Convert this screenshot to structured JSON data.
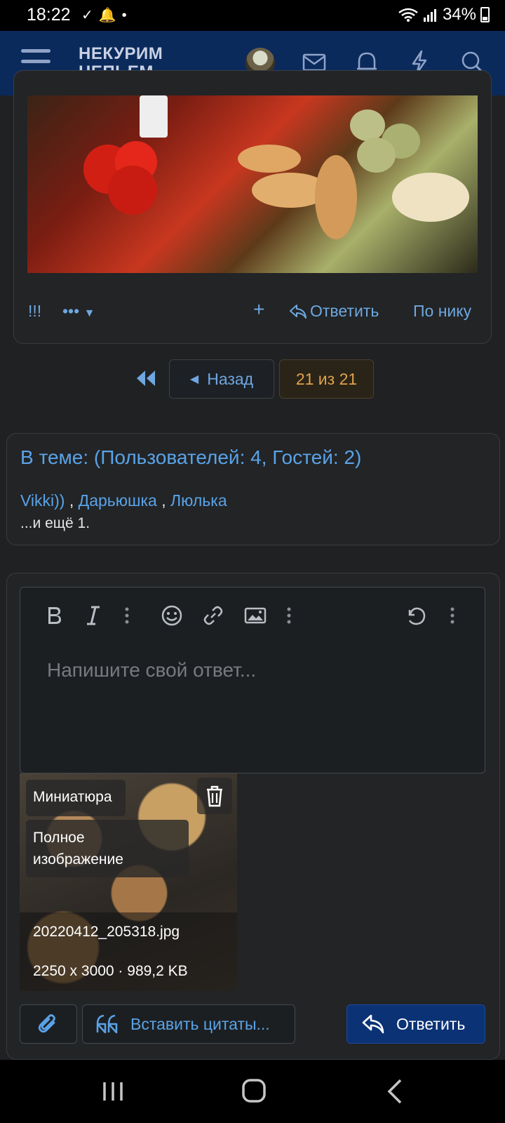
{
  "status_bar": {
    "time": "18:22",
    "battery": "34%"
  },
  "header": {
    "logo_line1": "НЕКУРИМ",
    "logo_line2": "НЕПЬЕМ..."
  },
  "post_actions": {
    "exclaim": "!!!",
    "more": "•••",
    "plus": "+",
    "reply": "Ответить",
    "by_nick": "По нику"
  },
  "pagination": {
    "back": "Назад",
    "current": "21 из 21"
  },
  "online": {
    "title": "В теме: (Пользователей: 4, Гостей: 2)",
    "users": [
      "Vikki))",
      "Дарьюшка",
      "Люлька"
    ],
    "separator": ",",
    "more": "...и ещё 1."
  },
  "editor": {
    "placeholder": "Напишите свой ответ..."
  },
  "attachment": {
    "thumb_label": "Миниатюра",
    "full_label_line1": "Полное",
    "full_label_line2": "изображение",
    "filename": "20220412_205318.jpg",
    "details": "2250 x 3000 · 989,2 KB"
  },
  "buttons": {
    "quote": "Вставить цитаты...",
    "reply": "Ответить"
  },
  "colors": {
    "header_bg": "#0b2a5c",
    "link": "#5aa3e8",
    "accent_orange": "#e0a24a",
    "primary_button": "#0b3275"
  },
  "icons": [
    "burger-icon",
    "avatar",
    "mail-icon",
    "bell-icon",
    "bolt-icon",
    "search-icon",
    "reply-icon",
    "bold-icon",
    "italic-icon",
    "emoji-icon",
    "link-icon",
    "image-icon",
    "undo-icon",
    "trash-icon",
    "paperclip-icon",
    "quote-icon"
  ]
}
